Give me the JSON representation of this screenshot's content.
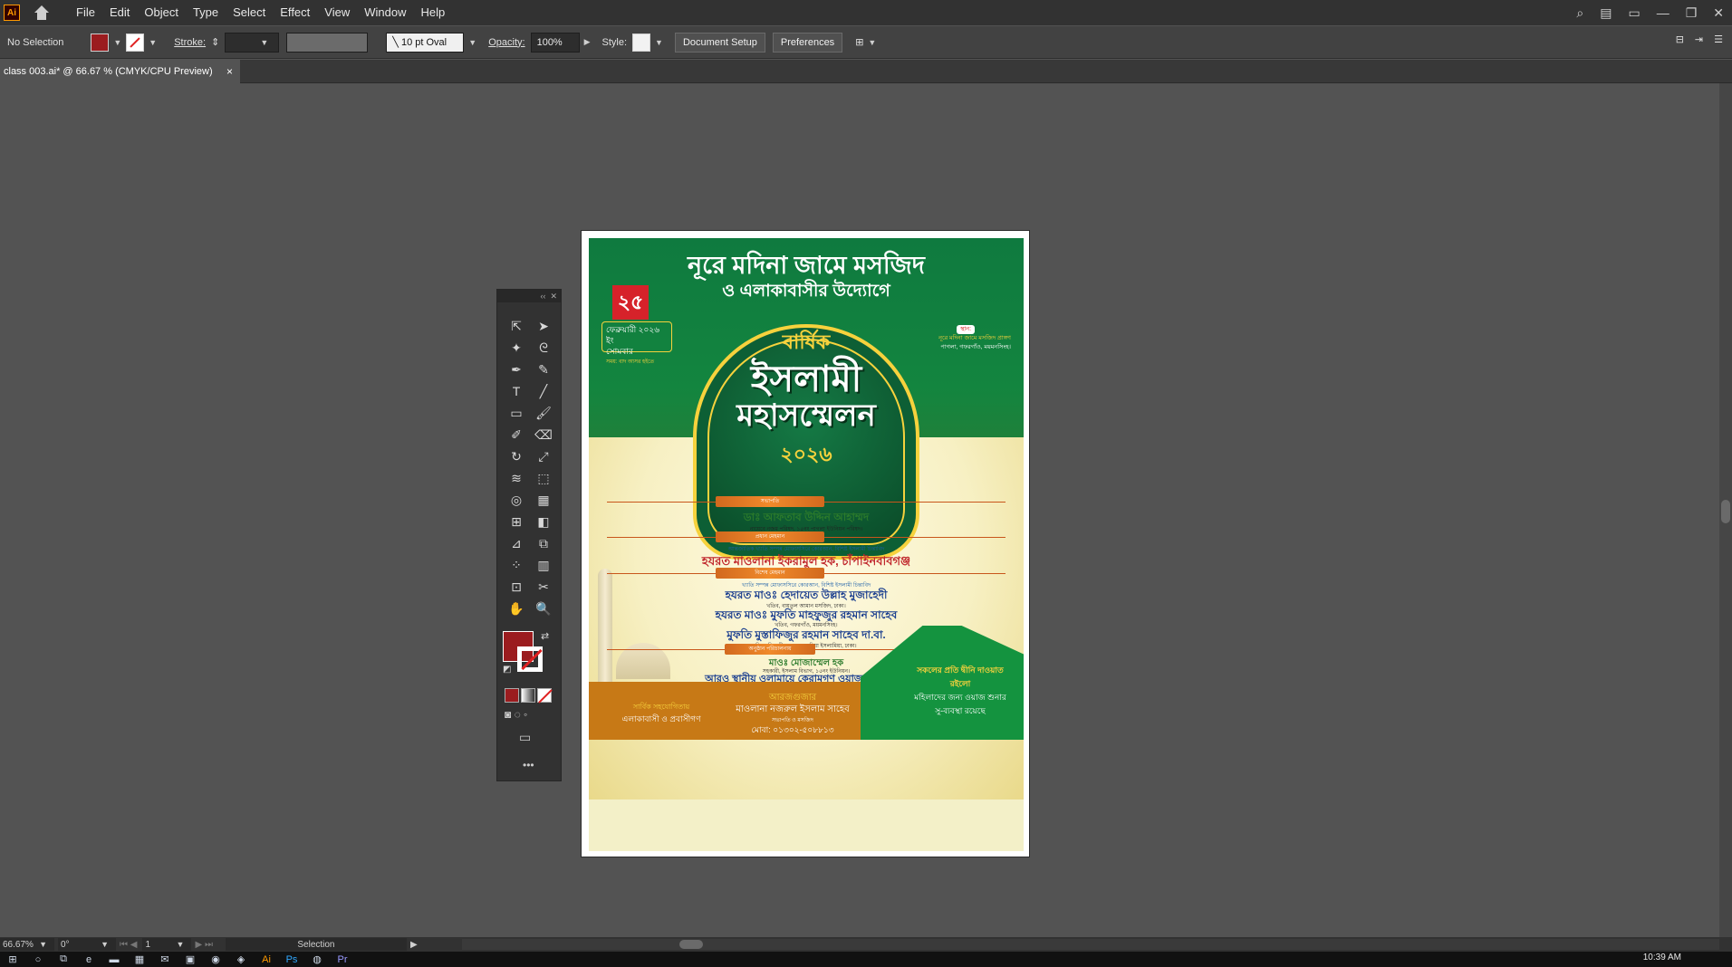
{
  "app": {
    "logo_text": "Ai",
    "window_buttons": [
      "—",
      "❐",
      "✕"
    ]
  },
  "menu": [
    "File",
    "Edit",
    "Object",
    "Type",
    "Select",
    "Effect",
    "View",
    "Window",
    "Help"
  ],
  "control": {
    "selection": "No Selection",
    "fill_color": "#9b1c1f",
    "stroke_label": "Stroke:",
    "brush": "10 pt Oval",
    "opacity_label": "Opacity:",
    "opacity_value": "100%",
    "style_label": "Style:",
    "doc_setup": "Document Setup",
    "preferences": "Preferences"
  },
  "tab": {
    "title": "class 003.ai* @ 66.67 % (CMYK/CPU Preview)",
    "close": "×"
  },
  "poster": {
    "headline": "নূরে মদিনা জামে মসজিদ",
    "subhead": "ও এলাকাবাসীর উদ্যোগে",
    "date_number": "২৫",
    "date_line1": "ফেব্রুয়ারী ২০২৬ ইং",
    "date_line2": "সোমবার",
    "date_time": "সময়: বাদ আসর হইতে",
    "venue_badge": "স্থান:",
    "venue_line1": "নূরে মদিনা জামে মসজিদ প্রাঙ্গণ",
    "venue_line2": "পাগলা, গফরগাঁও, ময়মনসিংহ।",
    "annual": "বার্ষিক",
    "title1": "ইসলামী",
    "title2": "মহাসম্মেলন",
    "year": "২০২৬",
    "role1": "সভাপতি",
    "name1": "ডাঃ আফতাব উদ্দিন আহাম্মদ",
    "desc1": "নায়েবে নজম পরিষদ, ১৫নং পাগলা ইউনিয়ন পরিষদ।",
    "role2": "প্রধান মেহমান",
    "desc2": "আন্তর্জাতিক খ্যাতি সম্পন্ন মোফাসসিরে কোরআন, বিশিষ্ট ইসলামী চিন্তাবিদ",
    "name2": "হযরত মাওলানা ইকরামুল হক, চাঁপাইনবাবগঞ্জ",
    "role3": "বিশেষ মেহমান",
    "desc3": "খ্যাতি সম্পন্ন মোফাসসিরে কোরআন, বিশিষ্ট ইসলামী চিন্তাবিদ",
    "name3": "হযরত মাওঃ হেদায়েত উল্লাহ মুজাহেদী",
    "desc3b": "খতিব, বায়তুল আমান মসজিদ, ঢাকা।",
    "name4": "হযরত মাওঃ মুফতি মাহফুজুর রহমান সাহেব",
    "desc4": "খতিব, গফরগাঁও, ময়মনসিংহ।",
    "name5": "মুফতি মুস্তাফিজুর রহমান সাহেব দা.বা.",
    "desc5": "শিক্ষা বিভাগীয় প্রধান, জামিয়া ইসলামিয়া, ঢাকা।",
    "role4": "অনুষ্ঠান পরিচালনায়",
    "name6": "মাওঃ মোজাম্মেল হক",
    "desc6": "সহকারী, ইসলাম বিভাগ, ১৫নং ইউনিয়ন।",
    "more": "আরও স্থানীয় ওলামায়ে কেরামগণ ওয়াজ ফরমাইবেন",
    "green_text1": "সকলের প্রতি দ্বীনি দাওয়াত রইলো",
    "green_text2": "মহিলাদের জন্য ওয়াজ শুনার সু-ব্যবস্থা রয়েছে",
    "support_title": "সার্বিক সহযোগিতায়",
    "support": "এলাকাবাসী ও প্রবাসীগণ",
    "organizer_title": "আরজগুজার",
    "organizer": "মাওলানা নজরুল ইসলাম সাহেব",
    "organizer_role": "সভাপতি ও মসজিদ",
    "phone": "মোবা: ০১৩০২-৫০৮৮১৩"
  },
  "status": {
    "zoom": "66.67%",
    "rotate": "0°",
    "page": "1",
    "mode": "Selection"
  },
  "taskbar": {
    "time": "10:39 AM"
  }
}
